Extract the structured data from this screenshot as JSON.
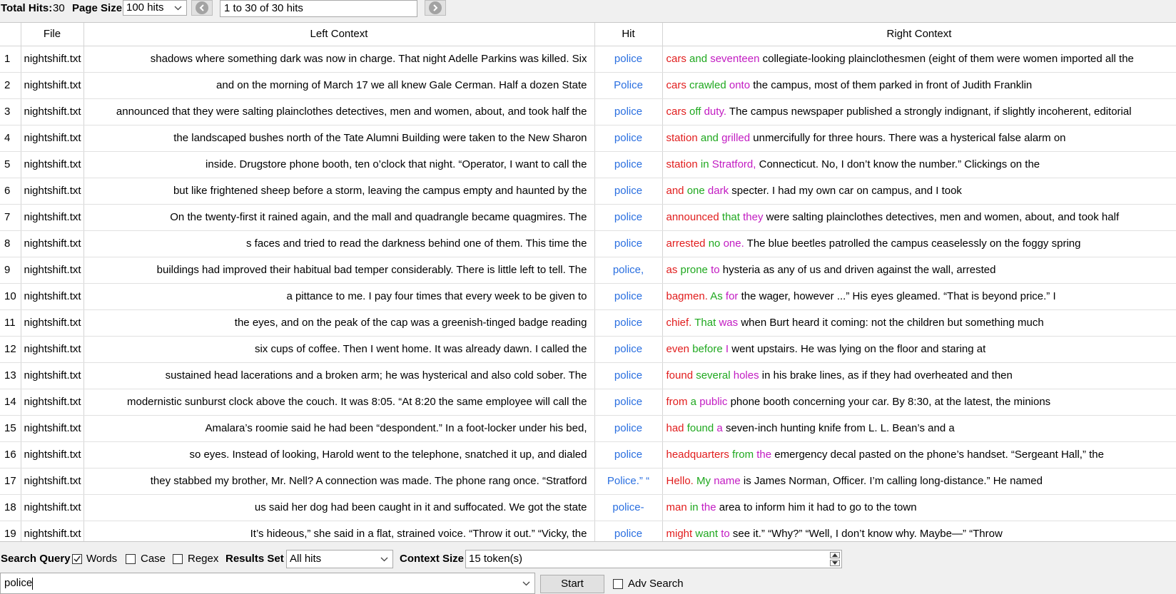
{
  "topbar": {
    "total_hits_label": "Total Hits:",
    "total_hits_value": "30",
    "page_size_label": "Page Size",
    "page_size_value": "100 hits",
    "range_text": "1 to 30 of 30 hits"
  },
  "table": {
    "columns": [
      "",
      "File",
      "Left Context",
      "Hit",
      "Right Context"
    ],
    "rows": [
      {
        "num": "1",
        "file": "nightshift.txt",
        "left": "shadows where something dark was now in charge. That night Adelle Parkins was killed. Six",
        "hit": "police",
        "r1": "cars",
        "r2": "and",
        "r3": "seventeen",
        "rest": "collegiate-looking plainclothesmen (eight of them were women imported all the"
      },
      {
        "num": "2",
        "file": "nightshift.txt",
        "left": "and on the morning of March 17 we all knew Gale Cerman. Half a dozen State",
        "hit": "Police",
        "r1": "cars",
        "r2": "crawled",
        "r3": "onto",
        "rest": "the campus, most of them parked in front of Judith Franklin"
      },
      {
        "num": "3",
        "file": "nightshift.txt",
        "left": "announced that they were salting plainclothes detectives, men and women, about, and took half the",
        "hit": "police",
        "r1": "cars",
        "r2": "off",
        "r3": "duty.",
        "rest": "The campus newspaper published a strongly indignant, if slightly incoherent, editorial"
      },
      {
        "num": "4",
        "file": "nightshift.txt",
        "left": "the landscaped bushes north of the Tate Alumni Building were taken to the New Sharon",
        "hit": "police",
        "r1": "station",
        "r2": "and",
        "r3": "grilled",
        "rest": "unmercifully for three hours. There was a hysterical false alarm on"
      },
      {
        "num": "5",
        "file": "nightshift.txt",
        "left": "inside. Drugstore phone booth, ten o’clock that night. “Operator, I want to call the",
        "hit": "police",
        "r1": "station",
        "r2": "in",
        "r3": "Stratford,",
        "rest": "Connecticut. No, I don’t know the number.” Clickings on the"
      },
      {
        "num": "6",
        "file": "nightshift.txt",
        "left": "but like frightened sheep before a storm, leaving the campus empty and haunted by the",
        "hit": "police",
        "r1": "and",
        "r2": "one",
        "r3": "dark",
        "rest": "specter. I had my own car on campus, and I took"
      },
      {
        "num": "7",
        "file": "nightshift.txt",
        "left": "On the twenty-first it rained again, and the mall and quadrangle became quagmires. The",
        "hit": "police",
        "r1": "announced",
        "r2": "that",
        "r3": "they",
        "rest": "were salting plainclothes detectives, men and women, about, and took half"
      },
      {
        "num": "8",
        "file": "nightshift.txt",
        "left": "s faces and tried to read the darkness behind one of them. This time the",
        "hit": "police",
        "r1": "arrested",
        "r2": "no",
        "r3": "one.",
        "rest": "The blue beetles patrolled the campus ceaselessly on the foggy spring"
      },
      {
        "num": "9",
        "file": "nightshift.txt",
        "left": "buildings had improved their habitual bad temper considerably. There is little left to tell. The",
        "hit": "police,",
        "r1": "as",
        "r2": "prone",
        "r3": "to",
        "rest": "hysteria as any of us and driven against the wall, arrested"
      },
      {
        "num": "10",
        "file": "nightshift.txt",
        "left": "a pittance to me. I pay four times that every week to be given to",
        "hit": "police",
        "r1": "bagmen.",
        "r2": "As",
        "r3": "for",
        "rest": "the wager, however ...” His eyes gleamed. “That is beyond price.” I"
      },
      {
        "num": "11",
        "file": "nightshift.txt",
        "left": "the eyes, and on the peak of the cap was a greenish-tinged badge reading",
        "hit": "police",
        "r1": "chief.",
        "r2": "That",
        "r3": "was",
        "rest": "when Burt heard it coming: not the children but something much"
      },
      {
        "num": "12",
        "file": "nightshift.txt",
        "left": "six cups of coffee. Then I went home. It was already dawn. I called the",
        "hit": "police",
        "r1": "even",
        "r2": "before",
        "r3": "I",
        "rest": "went upstairs. He was lying on the floor and staring at"
      },
      {
        "num": "13",
        "file": "nightshift.txt",
        "left": "sustained head lacerations and a broken arm; he was hysterical and also cold sober. The",
        "hit": "police",
        "r1": "found",
        "r2": "several",
        "r3": "holes",
        "rest": "in his brake lines, as if they had overheated and then"
      },
      {
        "num": "14",
        "file": "nightshift.txt",
        "left": "modernistic sunburst clock above the couch. It was 8:05. “At 8:20 the same employee will call the",
        "hit": "police",
        "r1": "from",
        "r2": "a",
        "r3": "public",
        "rest": "phone booth concerning your car. By 8:30, at the latest, the minions"
      },
      {
        "num": "15",
        "file": "nightshift.txt",
        "left": "Amalara’s roomie said he had been “despondent.” In a foot-locker under his bed,",
        "hit": "police",
        "r1": "had",
        "r2": "found",
        "r3": "a",
        "rest": "seven-inch hunting knife from L. L. Bean’s and a"
      },
      {
        "num": "16",
        "file": "nightshift.txt",
        "left": "so eyes. Instead of looking, Harold went to the telephone, snatched it up, and dialed",
        "hit": "police",
        "r1": "headquarters",
        "r2": "from",
        "r3": "the",
        "rest": "emergency decal pasted on the phone’s handset. “Sergeant Hall,” the"
      },
      {
        "num": "17",
        "file": "nightshift.txt",
        "left": "they stabbed my brother, Mr. Nell? A connection was made. The phone rang once. “Stratford",
        "hit": "Police.” “",
        "r1": "Hello.",
        "r2": "My",
        "r3": "name",
        "rest": "is James Norman, Officer. I’m calling long-distance.” He named"
      },
      {
        "num": "18",
        "file": "nightshift.txt",
        "left": "us said her dog had been caught in it and suffocated. We got the state",
        "hit": "police-",
        "r1": "man",
        "r2": "in",
        "r3": "the",
        "rest": "area to inform him it had to go to the town"
      },
      {
        "num": "19",
        "file": "nightshift.txt",
        "left": "It’s hideous,” she said in a flat, strained voice. “Throw it out.” “Vicky, the",
        "hit": "police",
        "r1": "might",
        "r2": "want",
        "r3": "to",
        "rest": "see it.” “Why?” “Well, I don’t know why. Maybe—” “Throw"
      }
    ]
  },
  "bottombar": {
    "search_query_label": "Search Query",
    "words_label": "Words",
    "words_checked": true,
    "case_label": "Case",
    "case_checked": false,
    "regex_label": "Regex",
    "regex_checked": false,
    "results_set_label": "Results Set",
    "results_set_value": "All hits",
    "context_size_label": "Context Size",
    "context_size_value": "15 token(s)",
    "query_value": "police",
    "start_label": "Start",
    "adv_search_label": "Adv Search",
    "adv_search_checked": false
  },
  "colors": {
    "hit": "#2a6fe0",
    "right_token_1": "#e11d1d",
    "right_token_2": "#1fa81f",
    "right_token_3": "#c21bc2"
  },
  "icons": {
    "prev_page": "arrow-left-icon",
    "next_page": "arrow-right-icon",
    "dropdown": "chevron-down-icon",
    "checkmark": "checkmark-icon"
  }
}
